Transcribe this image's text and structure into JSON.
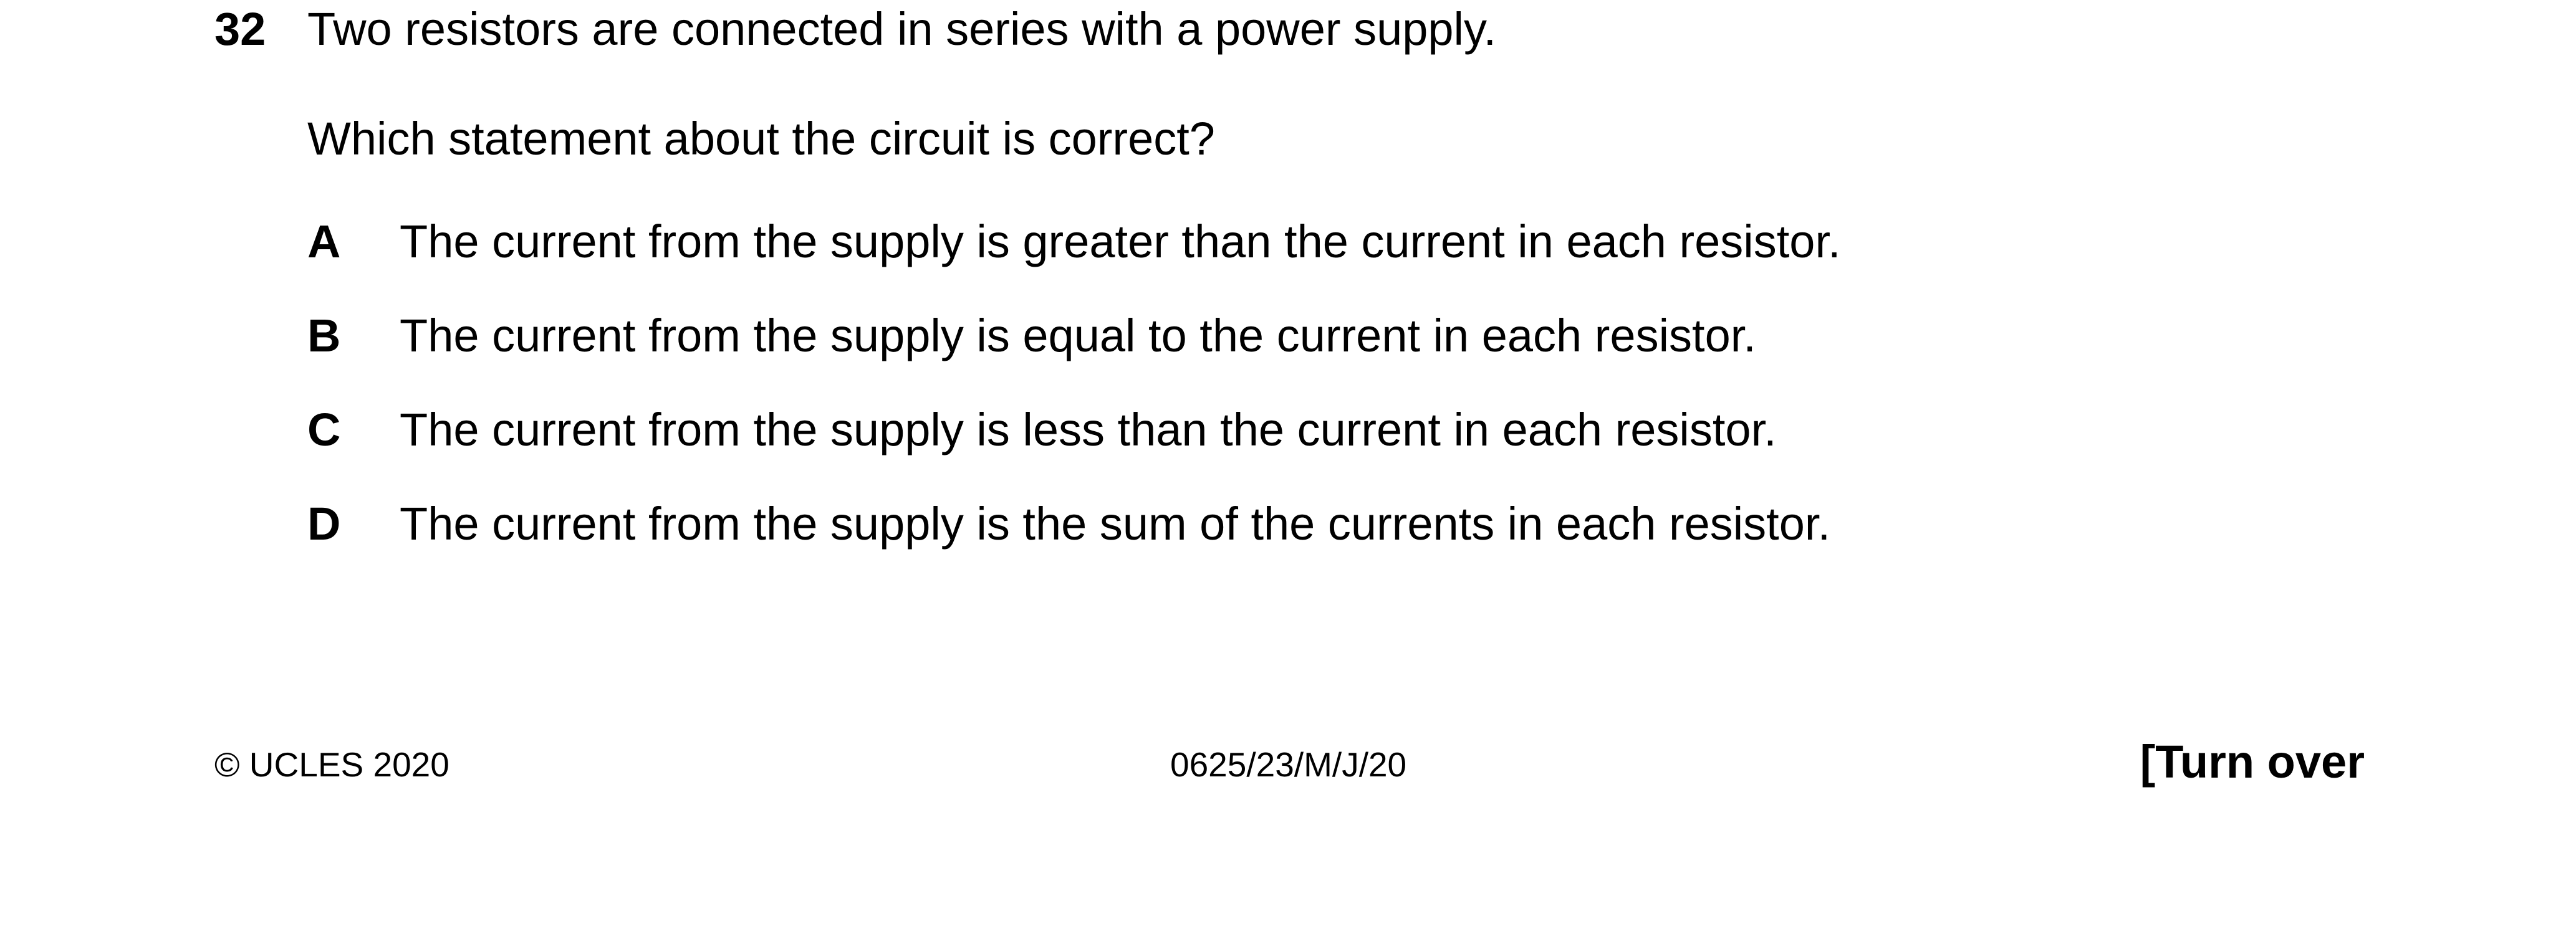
{
  "question": {
    "number": "32",
    "stem_line_1": "Two resistors are connected in series with a power supply.",
    "stem_line_2": "Which statement about the circuit is correct?"
  },
  "options": [
    {
      "letter": "A",
      "text": "The current from the supply is greater than the current in each resistor."
    },
    {
      "letter": "B",
      "text": "The current from the supply is equal to the current in each resistor."
    },
    {
      "letter": "C",
      "text": "The current from the supply is less than the current in each resistor."
    },
    {
      "letter": "D",
      "text": "The current from the supply is the sum of the currents in each resistor."
    }
  ],
  "footer": {
    "copyright": "© UCLES 2020",
    "paper_code": "0625/23/M/J/20",
    "turn_over": "[Turn over"
  }
}
